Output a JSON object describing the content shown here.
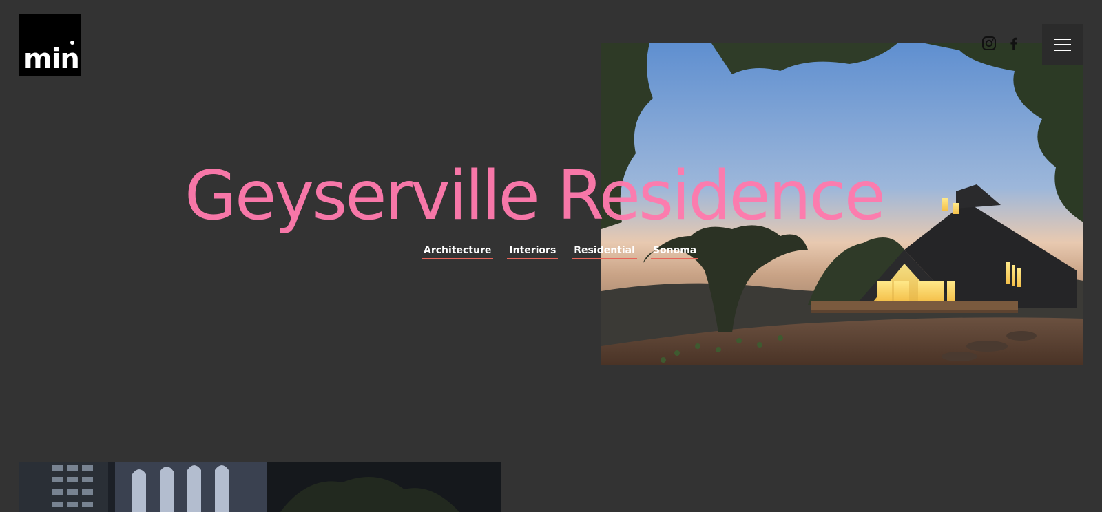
{
  "logo": {
    "text": "min",
    "icon": "min-logo-icon"
  },
  "hero": {
    "title": "Geyserville Residence",
    "tags": [
      "Architecture",
      "Interiors",
      "Residential",
      "Sonoma"
    ],
    "photo_description_icon": "house-photo-icon"
  },
  "header": {
    "social_icons": [
      "instagram-icon",
      "facebook-icon"
    ],
    "menu_icon": "hamburger-menu-icon"
  },
  "colors": {
    "background": "#333333",
    "title": "#ff7aad",
    "tag_underline": "#e8665a",
    "tag_text": "#ffffff",
    "logo_bg": "#000000"
  }
}
